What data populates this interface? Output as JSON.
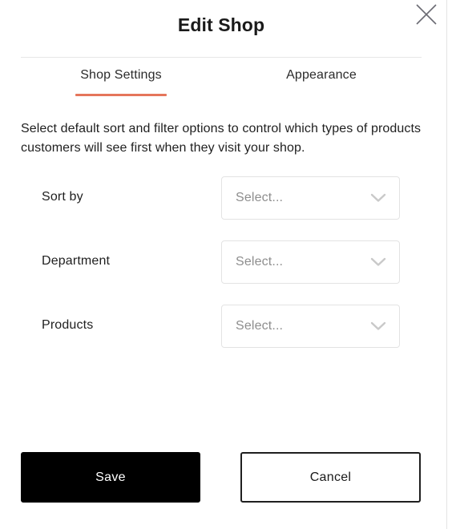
{
  "dialog": {
    "title": "Edit Shop",
    "close_icon": "close-icon",
    "accent_color": "#e5755b",
    "border_color": "#e3e3e3"
  },
  "tabs": [
    {
      "label": "Shop Settings",
      "active": true
    },
    {
      "label": "Appearance",
      "active": false
    }
  ],
  "description": "Select default sort and filter options to control which types of products customers will see first when they visit your shop.",
  "form": {
    "rows": [
      {
        "label": "Sort by",
        "placeholder": "Select...",
        "value": "",
        "chevron_icon": "chevron-down-icon"
      },
      {
        "label": "Department",
        "placeholder": "Select...",
        "value": "",
        "chevron_icon": "chevron-down-icon"
      },
      {
        "label": "Products",
        "placeholder": "Select...",
        "value": "",
        "chevron_icon": "chevron-down-icon"
      }
    ]
  },
  "footer": {
    "save_label": "Save",
    "cancel_label": "Cancel"
  }
}
